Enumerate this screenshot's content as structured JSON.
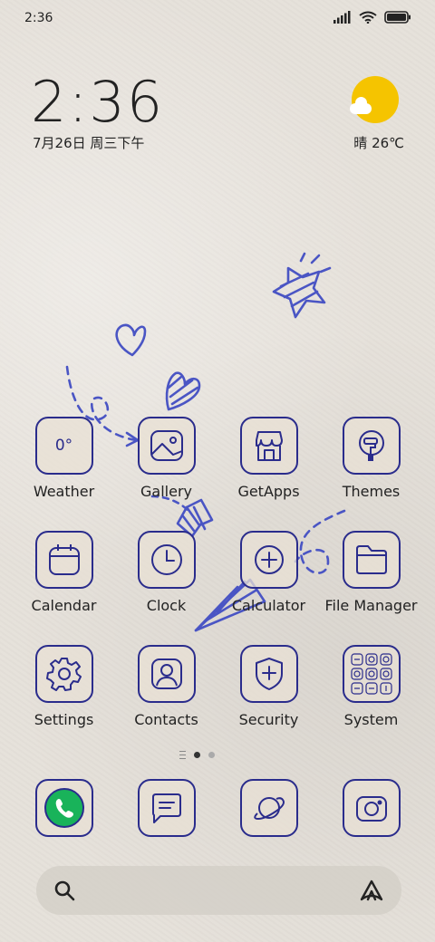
{
  "status_bar": {
    "time": "2:36",
    "icons": [
      "signal-icon",
      "wifi-icon",
      "battery-icon"
    ]
  },
  "widget": {
    "time": "2:36",
    "date": "7月26日 周三下午",
    "weather": "晴 26℃",
    "weather_icon": "sun-cloud-icon"
  },
  "apps": {
    "weather": {
      "label": "Weather",
      "icon_text": "0°"
    },
    "gallery": {
      "label": "Gallery"
    },
    "getapps": {
      "label": "GetApps"
    },
    "themes": {
      "label": "Themes"
    },
    "calendar": {
      "label": "Calendar"
    },
    "clock": {
      "label": "Clock"
    },
    "calculator": {
      "label": "Calculator"
    },
    "file_manager": {
      "label": "File Manager"
    },
    "settings": {
      "label": "Settings"
    },
    "contacts": {
      "label": "Contacts"
    },
    "security": {
      "label": "Security"
    },
    "system": {
      "label": "System"
    }
  },
  "dock": [
    "phone-icon",
    "messages-icon",
    "browser-icon",
    "camera-icon"
  ],
  "page_indicator": {
    "current": 1,
    "total": 2
  },
  "colors": {
    "accent": "#2a2c8c",
    "sun": "#f5c400",
    "phone_green": "#19b35a"
  }
}
